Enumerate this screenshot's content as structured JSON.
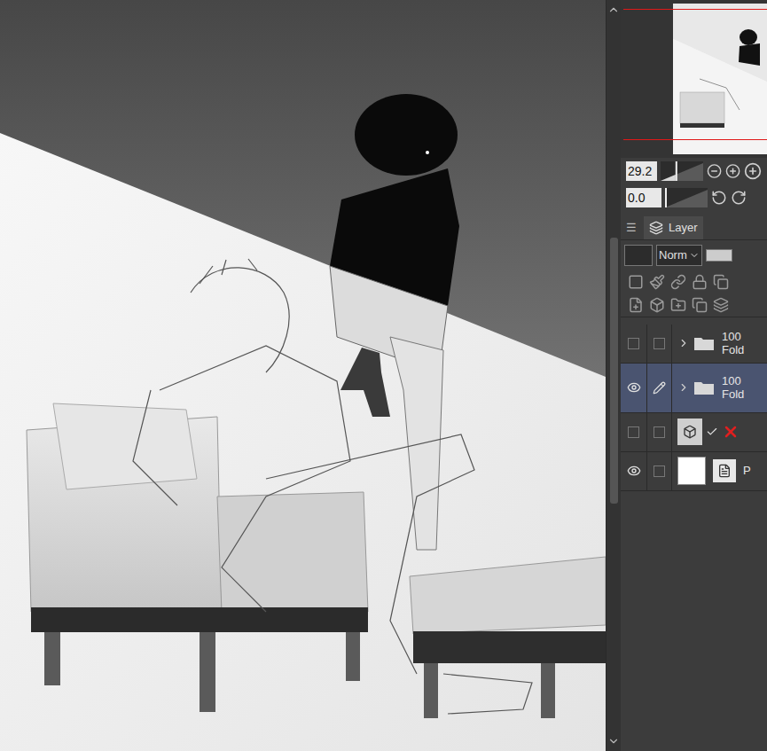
{
  "navigator": {
    "zoom": "29.2",
    "zoom_level": 0.35,
    "rotation": "0.0"
  },
  "palette": {
    "menu": "☰",
    "tab": "Layer"
  },
  "blend_mode": "Norm",
  "layers": [
    {
      "kind": "folder",
      "opacity": "100",
      "name": "Fold",
      "visible": false,
      "editing": false,
      "selected": false,
      "expanded": false
    },
    {
      "kind": "folder",
      "opacity": "100",
      "name": "Fold",
      "visible": true,
      "editing": true,
      "selected": true,
      "expanded": false
    },
    {
      "kind": "3d",
      "visible": false,
      "editing": false,
      "selected": false,
      "checked": true
    },
    {
      "kind": "paper",
      "name": "P",
      "visible": true,
      "editing": false,
      "selected": false
    }
  ]
}
